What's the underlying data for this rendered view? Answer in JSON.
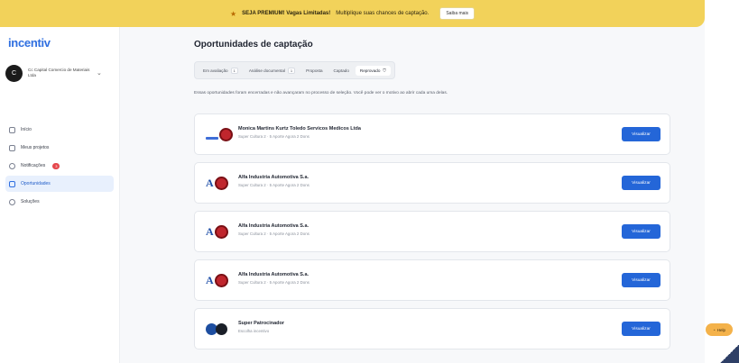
{
  "banner": {
    "text_strong": "SEJA PREMIUM! Vagas Limitadas!",
    "text": "Multiplique suas chances de captação.",
    "button_label": "Saiba mais",
    "colors": {
      "background": "#f2d25a"
    }
  },
  "sidebar": {
    "logo": "incentiv",
    "account": {
      "avatar_letter": "C",
      "name": "Cc Capital Comercio de Materiais Ltda"
    },
    "items": [
      {
        "label": "Início",
        "icon": "home-icon"
      },
      {
        "label": "Meus projetos",
        "icon": "folder-icon"
      },
      {
        "label": "Notificações",
        "icon": "bell-icon",
        "badge": "3"
      },
      {
        "label": "Oportunidades",
        "icon": "briefcase-icon",
        "active": true
      },
      {
        "label": "Soluções",
        "icon": "bulb-icon"
      }
    ]
  },
  "main": {
    "title": "Oportunidades de captação",
    "tabs": [
      {
        "label": "Em avaliação",
        "count": "1"
      },
      {
        "label": "Análise documental",
        "count": "1"
      },
      {
        "label": "Proposta"
      },
      {
        "label": "Captado"
      },
      {
        "label": "Reprovado",
        "active": true
      }
    ],
    "description": "Essas oportunidades foram encerradas e não avançaram no processo de seleção. Você pode ver o motivo ao abrir cada uma delas.",
    "cards": [
      {
        "name": "Monica Martins Kurtz Toledo Servicos Medicos Ltda",
        "sub": "Super Cultura 2 · 5 Aporte Agora 2 Dons",
        "logo": "bar",
        "button": "Visualizar"
      },
      {
        "name": "Alfa Industria Automotiva S.a.",
        "sub": "Super Cultura 2 · 5 Aporte Agora 2 Dons",
        "logo": "alfa",
        "button": "Visualizar"
      },
      {
        "name": "Alfa Industria Automotiva S.a.",
        "sub": "Super Cultura 2 · 5 Aporte Agora 2 Dons",
        "logo": "alfa",
        "button": "Visualizar"
      },
      {
        "name": "Alfa Industria Automotiva S.a.",
        "sub": "Super Cultura 2 · 5 Aporte Agora 2 Dons",
        "logo": "alfa",
        "button": "Visualizar"
      },
      {
        "name": "Super Patrocinador",
        "sub": "Escolha incentivo",
        "logo": "dots",
        "button": "Visualizar"
      }
    ],
    "colors": {
      "accent": "#2466d8",
      "brand": "#2f6fe0"
    }
  },
  "help": {
    "label": "Help",
    "icon": "chat-icon"
  }
}
